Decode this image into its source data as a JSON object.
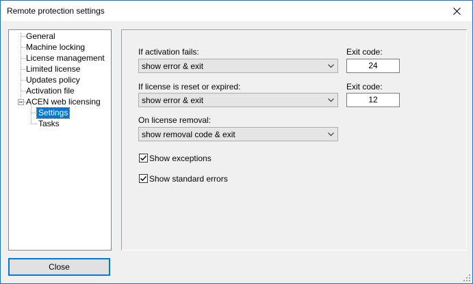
{
  "window": {
    "title": "Remote protection settings"
  },
  "tree": {
    "items": [
      {
        "label": "General"
      },
      {
        "label": "Machine locking"
      },
      {
        "label": "License management"
      },
      {
        "label": "Limited license"
      },
      {
        "label": "Updates policy"
      },
      {
        "label": "Activation file"
      },
      {
        "label": "ACEN web licensing",
        "expanded": true,
        "children": [
          {
            "label": "Settings",
            "selected": true
          },
          {
            "label": "Tasks"
          }
        ]
      }
    ]
  },
  "settings": {
    "activation_fails": {
      "label": "If activation fails:",
      "value": "show error & exit",
      "exit_label": "Exit code:",
      "exit_code": "24"
    },
    "license_reset": {
      "label": "If license is reset or expired:",
      "value": "show error & exit",
      "exit_label": "Exit code:",
      "exit_code": "12"
    },
    "license_removal": {
      "label": "On license removal:",
      "value": "show removal code & exit"
    },
    "show_exceptions": {
      "label": "Show exceptions",
      "checked": true
    },
    "show_standard_errors": {
      "label": "Show standard errors",
      "checked": true
    }
  },
  "buttons": {
    "close_label": "Close"
  },
  "colors": {
    "selection": "#0078d7",
    "window_border": "#1a6fbd"
  }
}
